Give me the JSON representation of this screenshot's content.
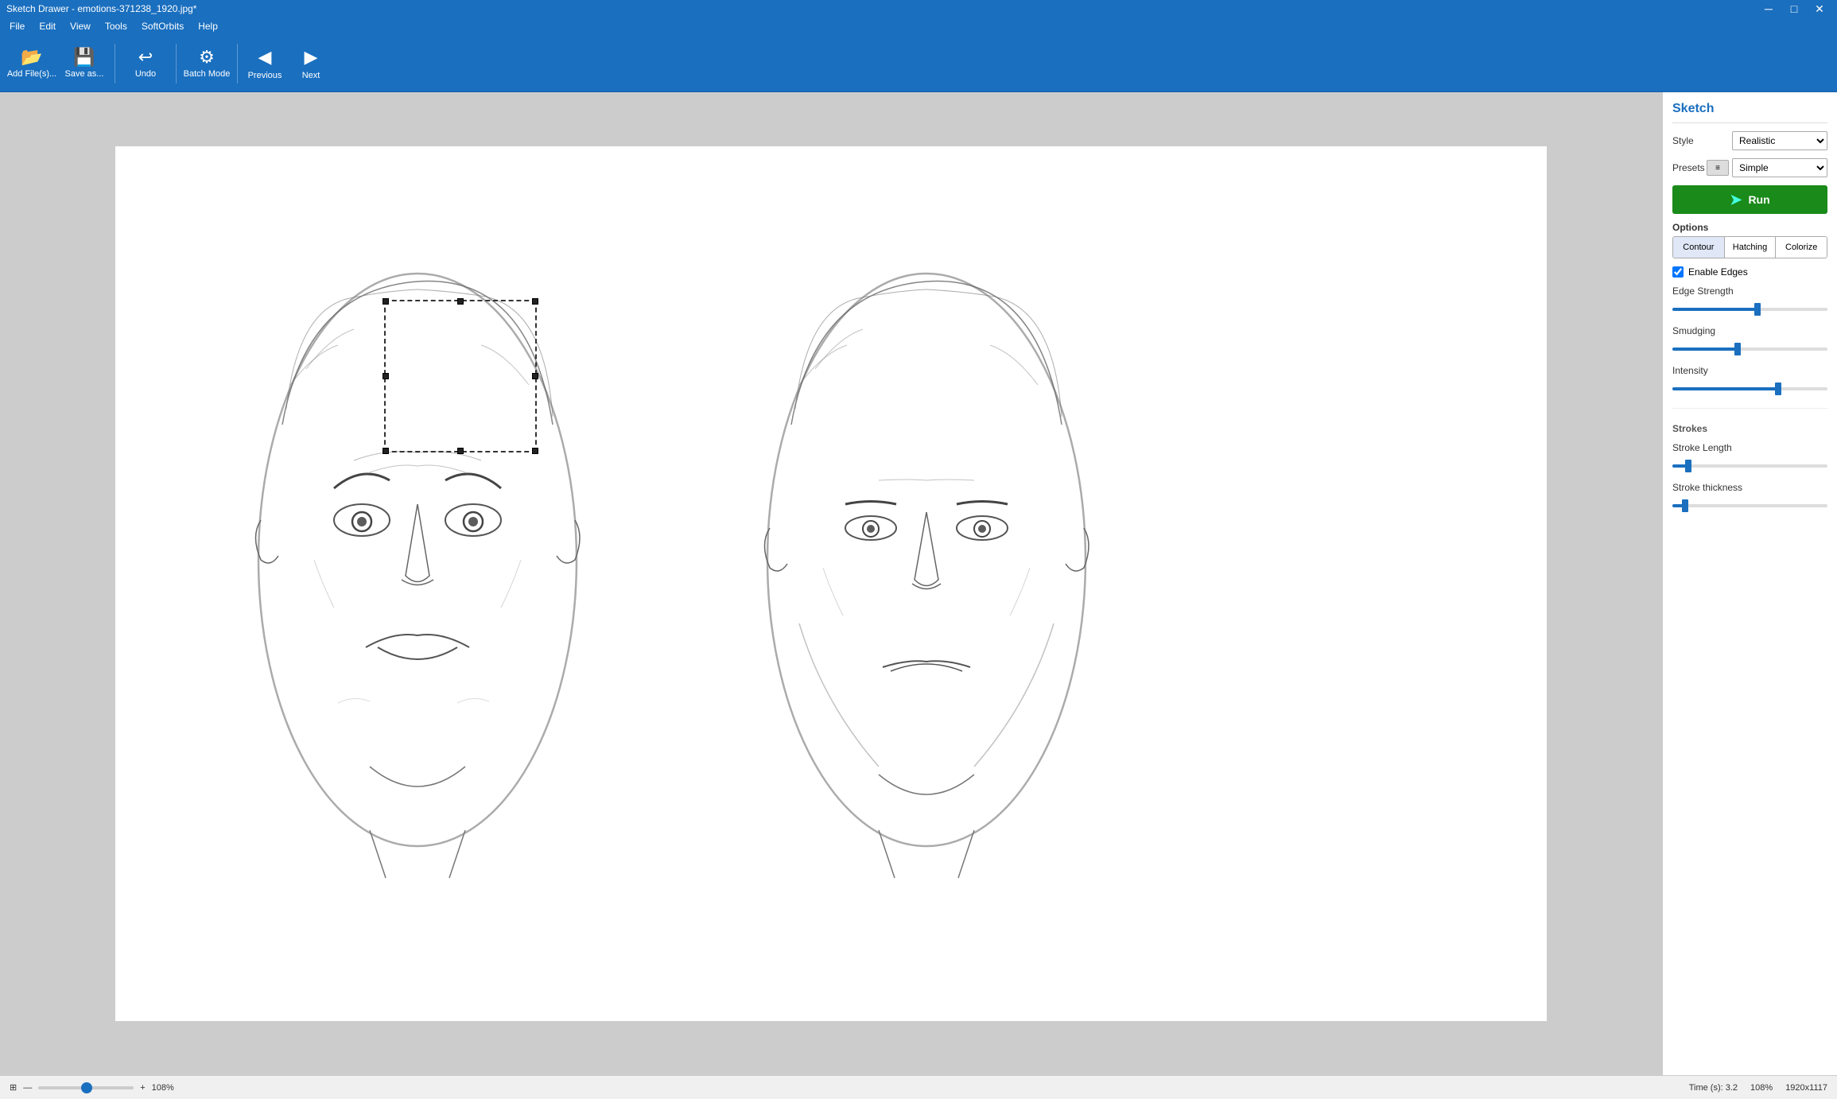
{
  "window": {
    "title": "Sketch Drawer - emotions-371238_1920.jpg*",
    "minimize": "─",
    "maximize": "□",
    "close": "✕"
  },
  "menu": {
    "items": [
      "File",
      "Edit",
      "View",
      "Tools",
      "SoftOrbits",
      "Help"
    ]
  },
  "toolbar": {
    "add_label": "Add File(s)...",
    "save_label": "Save as...",
    "undo_label": "Undo",
    "batch_label": "Batch Mode",
    "previous_label": "Previous",
    "next_label": "Next"
  },
  "panel": {
    "title": "Sketch",
    "style_label": "Style",
    "style_value": "Realistic",
    "presets_label": "Presets",
    "presets_value": "Simple",
    "run_label": "Run",
    "options_label": "Options",
    "tabs": [
      "Contour",
      "Hatching",
      "Colorize"
    ],
    "enable_edges_label": "Enable Edges",
    "edge_strength_label": "Edge Strength",
    "smudging_label": "Smudging",
    "intensity_label": "Intensity",
    "strokes_label": "Strokes",
    "stroke_length_label": "Stroke Length",
    "stroke_thickness_label": "Stroke thickness",
    "sliders": {
      "edge_strength": 55,
      "smudging": 42,
      "intensity": 68,
      "stroke_length": 10,
      "stroke_thickness": 8
    }
  },
  "statusbar": {
    "time_label": "Time (s): 3.2",
    "zoom_label": "108%",
    "resolution": "1920x1117",
    "zoom_value": "108%"
  }
}
